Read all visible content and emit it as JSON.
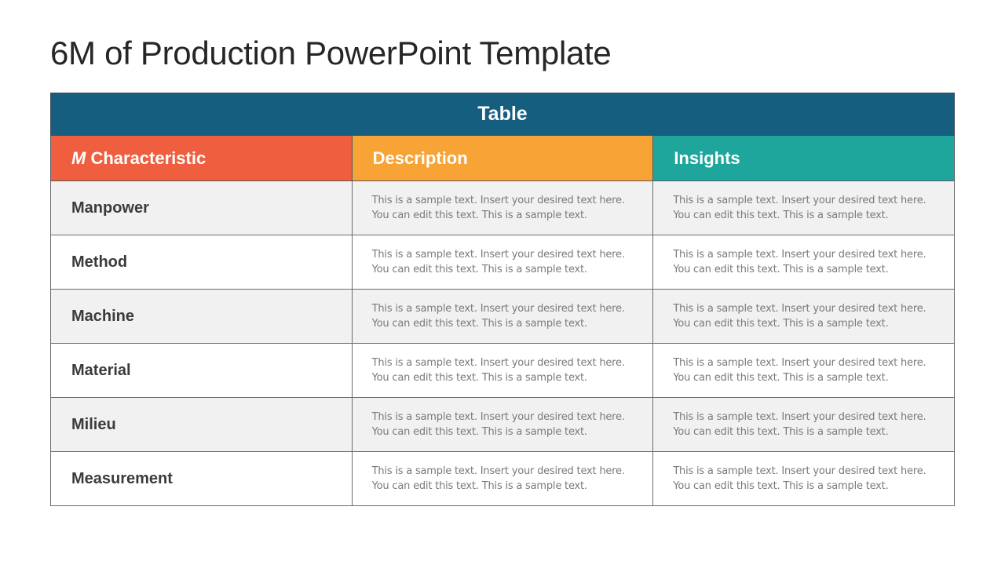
{
  "slide": {
    "title": "6M of Production PowerPoint Template"
  },
  "table": {
    "banner": "Table",
    "headers": {
      "col1_prefix": "M",
      "col1_rest": " Characteristic",
      "col2": "Description",
      "col3": "Insights"
    },
    "colors": {
      "banner": "#165e80",
      "characteristic": "#ee5e3f",
      "description": "#f7a335",
      "insights": "#1fa69c"
    },
    "rows": [
      {
        "name": "Manpower",
        "description": [
          "This is a sample text. Insert your desired text here.",
          "You can edit this text. This is a sample text."
        ],
        "insights": [
          "This is a sample text. Insert your desired text here.",
          "You can edit this text. This is a sample text."
        ]
      },
      {
        "name": "Method",
        "description": [
          "This is a sample text. Insert your desired text here.",
          "You can edit this text. This is a sample text."
        ],
        "insights": [
          "This is a sample text. Insert your desired text here.",
          "You can edit this text. This is a sample text."
        ]
      },
      {
        "name": "Machine",
        "description": [
          "This is a sample text. Insert your desired text here.",
          "You can edit this text. This is a sample text."
        ],
        "insights": [
          "This is a sample text. Insert your desired text here.",
          "You can edit this text. This is a sample text."
        ]
      },
      {
        "name": "Material",
        "description": [
          "This is a sample text. Insert your desired text here.",
          "You can edit this text. This is a sample text."
        ],
        "insights": [
          "This is a sample text. Insert your desired text here.",
          "You can edit this text. This is a sample text."
        ]
      },
      {
        "name": "Milieu",
        "description": [
          "This is a sample text. Insert your desired text here.",
          "You can edit this text. This is a sample text."
        ],
        "insights": [
          "This is a sample text. Insert your desired text here.",
          "You can edit this text. This is a sample text."
        ]
      },
      {
        "name": "Measurement",
        "description": [
          "This is a sample text. Insert your desired text here.",
          "You can edit this text. This is a sample text."
        ],
        "insights": [
          "This is a sample text. Insert your desired text here.",
          "You can edit this text. This is a sample text."
        ]
      }
    ]
  }
}
